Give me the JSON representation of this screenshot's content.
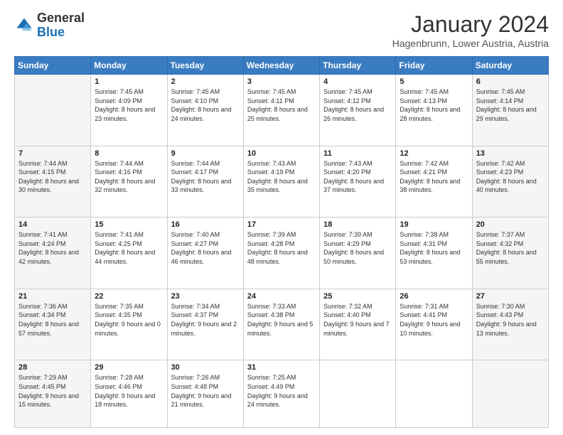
{
  "header": {
    "logo_general": "General",
    "logo_blue": "Blue",
    "month_title": "January 2024",
    "location": "Hagenbrunn, Lower Austria, Austria"
  },
  "days_of_week": [
    "Sunday",
    "Monday",
    "Tuesday",
    "Wednesday",
    "Thursday",
    "Friday",
    "Saturday"
  ],
  "weeks": [
    [
      {
        "day": "",
        "sunrise": "",
        "sunset": "",
        "daylight": ""
      },
      {
        "day": "1",
        "sunrise": "Sunrise: 7:45 AM",
        "sunset": "Sunset: 4:09 PM",
        "daylight": "Daylight: 8 hours and 23 minutes."
      },
      {
        "day": "2",
        "sunrise": "Sunrise: 7:45 AM",
        "sunset": "Sunset: 4:10 PM",
        "daylight": "Daylight: 8 hours and 24 minutes."
      },
      {
        "day": "3",
        "sunrise": "Sunrise: 7:45 AM",
        "sunset": "Sunset: 4:11 PM",
        "daylight": "Daylight: 8 hours and 25 minutes."
      },
      {
        "day": "4",
        "sunrise": "Sunrise: 7:45 AM",
        "sunset": "Sunset: 4:12 PM",
        "daylight": "Daylight: 8 hours and 26 minutes."
      },
      {
        "day": "5",
        "sunrise": "Sunrise: 7:45 AM",
        "sunset": "Sunset: 4:13 PM",
        "daylight": "Daylight: 8 hours and 28 minutes."
      },
      {
        "day": "6",
        "sunrise": "Sunrise: 7:45 AM",
        "sunset": "Sunset: 4:14 PM",
        "daylight": "Daylight: 8 hours and 29 minutes."
      }
    ],
    [
      {
        "day": "7",
        "sunrise": "Sunrise: 7:44 AM",
        "sunset": "Sunset: 4:15 PM",
        "daylight": "Daylight: 8 hours and 30 minutes."
      },
      {
        "day": "8",
        "sunrise": "Sunrise: 7:44 AM",
        "sunset": "Sunset: 4:16 PM",
        "daylight": "Daylight: 8 hours and 32 minutes."
      },
      {
        "day": "9",
        "sunrise": "Sunrise: 7:44 AM",
        "sunset": "Sunset: 4:17 PM",
        "daylight": "Daylight: 8 hours and 33 minutes."
      },
      {
        "day": "10",
        "sunrise": "Sunrise: 7:43 AM",
        "sunset": "Sunset: 4:19 PM",
        "daylight": "Daylight: 8 hours and 35 minutes."
      },
      {
        "day": "11",
        "sunrise": "Sunrise: 7:43 AM",
        "sunset": "Sunset: 4:20 PM",
        "daylight": "Daylight: 8 hours and 37 minutes."
      },
      {
        "day": "12",
        "sunrise": "Sunrise: 7:42 AM",
        "sunset": "Sunset: 4:21 PM",
        "daylight": "Daylight: 8 hours and 38 minutes."
      },
      {
        "day": "13",
        "sunrise": "Sunrise: 7:42 AM",
        "sunset": "Sunset: 4:23 PM",
        "daylight": "Daylight: 8 hours and 40 minutes."
      }
    ],
    [
      {
        "day": "14",
        "sunrise": "Sunrise: 7:41 AM",
        "sunset": "Sunset: 4:24 PM",
        "daylight": "Daylight: 8 hours and 42 minutes."
      },
      {
        "day": "15",
        "sunrise": "Sunrise: 7:41 AM",
        "sunset": "Sunset: 4:25 PM",
        "daylight": "Daylight: 8 hours and 44 minutes."
      },
      {
        "day": "16",
        "sunrise": "Sunrise: 7:40 AM",
        "sunset": "Sunset: 4:27 PM",
        "daylight": "Daylight: 8 hours and 46 minutes."
      },
      {
        "day": "17",
        "sunrise": "Sunrise: 7:39 AM",
        "sunset": "Sunset: 4:28 PM",
        "daylight": "Daylight: 8 hours and 48 minutes."
      },
      {
        "day": "18",
        "sunrise": "Sunrise: 7:39 AM",
        "sunset": "Sunset: 4:29 PM",
        "daylight": "Daylight: 8 hours and 50 minutes."
      },
      {
        "day": "19",
        "sunrise": "Sunrise: 7:38 AM",
        "sunset": "Sunset: 4:31 PM",
        "daylight": "Daylight: 8 hours and 53 minutes."
      },
      {
        "day": "20",
        "sunrise": "Sunrise: 7:37 AM",
        "sunset": "Sunset: 4:32 PM",
        "daylight": "Daylight: 8 hours and 55 minutes."
      }
    ],
    [
      {
        "day": "21",
        "sunrise": "Sunrise: 7:36 AM",
        "sunset": "Sunset: 4:34 PM",
        "daylight": "Daylight: 8 hours and 57 minutes."
      },
      {
        "day": "22",
        "sunrise": "Sunrise: 7:35 AM",
        "sunset": "Sunset: 4:35 PM",
        "daylight": "Daylight: 9 hours and 0 minutes."
      },
      {
        "day": "23",
        "sunrise": "Sunrise: 7:34 AM",
        "sunset": "Sunset: 4:37 PM",
        "daylight": "Daylight: 9 hours and 2 minutes."
      },
      {
        "day": "24",
        "sunrise": "Sunrise: 7:33 AM",
        "sunset": "Sunset: 4:38 PM",
        "daylight": "Daylight: 9 hours and 5 minutes."
      },
      {
        "day": "25",
        "sunrise": "Sunrise: 7:32 AM",
        "sunset": "Sunset: 4:40 PM",
        "daylight": "Daylight: 9 hours and 7 minutes."
      },
      {
        "day": "26",
        "sunrise": "Sunrise: 7:31 AM",
        "sunset": "Sunset: 4:41 PM",
        "daylight": "Daylight: 9 hours and 10 minutes."
      },
      {
        "day": "27",
        "sunrise": "Sunrise: 7:30 AM",
        "sunset": "Sunset: 4:43 PM",
        "daylight": "Daylight: 9 hours and 13 minutes."
      }
    ],
    [
      {
        "day": "28",
        "sunrise": "Sunrise: 7:29 AM",
        "sunset": "Sunset: 4:45 PM",
        "daylight": "Daylight: 9 hours and 15 minutes."
      },
      {
        "day": "29",
        "sunrise": "Sunrise: 7:28 AM",
        "sunset": "Sunset: 4:46 PM",
        "daylight": "Daylight: 9 hours and 18 minutes."
      },
      {
        "day": "30",
        "sunrise": "Sunrise: 7:26 AM",
        "sunset": "Sunset: 4:48 PM",
        "daylight": "Daylight: 9 hours and 21 minutes."
      },
      {
        "day": "31",
        "sunrise": "Sunrise: 7:25 AM",
        "sunset": "Sunset: 4:49 PM",
        "daylight": "Daylight: 9 hours and 24 minutes."
      },
      {
        "day": "",
        "sunrise": "",
        "sunset": "",
        "daylight": ""
      },
      {
        "day": "",
        "sunrise": "",
        "sunset": "",
        "daylight": ""
      },
      {
        "day": "",
        "sunrise": "",
        "sunset": "",
        "daylight": ""
      }
    ]
  ]
}
